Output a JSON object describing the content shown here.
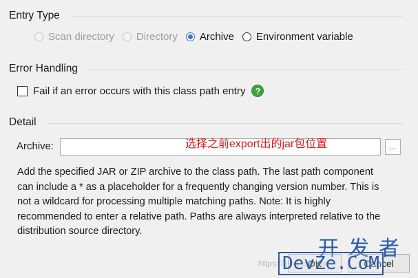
{
  "entry_type": {
    "title": "Entry Type",
    "options": [
      {
        "label": "Scan directory",
        "state": "disabled"
      },
      {
        "label": "Directory",
        "state": "disabled"
      },
      {
        "label": "Archive",
        "state": "selected"
      },
      {
        "label": "Environment variable",
        "state": "enabled"
      }
    ]
  },
  "error_handling": {
    "title": "Error Handling",
    "checkbox_label": "Fail if an error occurs with this class path entry",
    "checked": false,
    "help_glyph": "?"
  },
  "detail": {
    "title": "Detail",
    "archive_label": "Archive:",
    "archive_value": "",
    "browse_label": "...",
    "annotation": "选择之前export出的jar包位置",
    "description": "Add the specified JAR or ZIP archive to the class path. The last path component can include a * as a placeholder for a frequently changing version number. This is not a wildcard for processing multiple matching paths. Note: It is highly recommended to enter a relative path. Paths are always interpreted relative to the distribution source directory."
  },
  "buttons": {
    "ok_label": "OK",
    "cancel_label": "Cancel"
  },
  "watermark": {
    "faint": "https://blog.csdn.net",
    "cn": "开发者",
    "en": "DevZe.CoM"
  },
  "colors": {
    "accent": "#3f76c4",
    "help": "#3aa63a",
    "annotation": "#e01818",
    "watermark": "#2a5aa8"
  }
}
